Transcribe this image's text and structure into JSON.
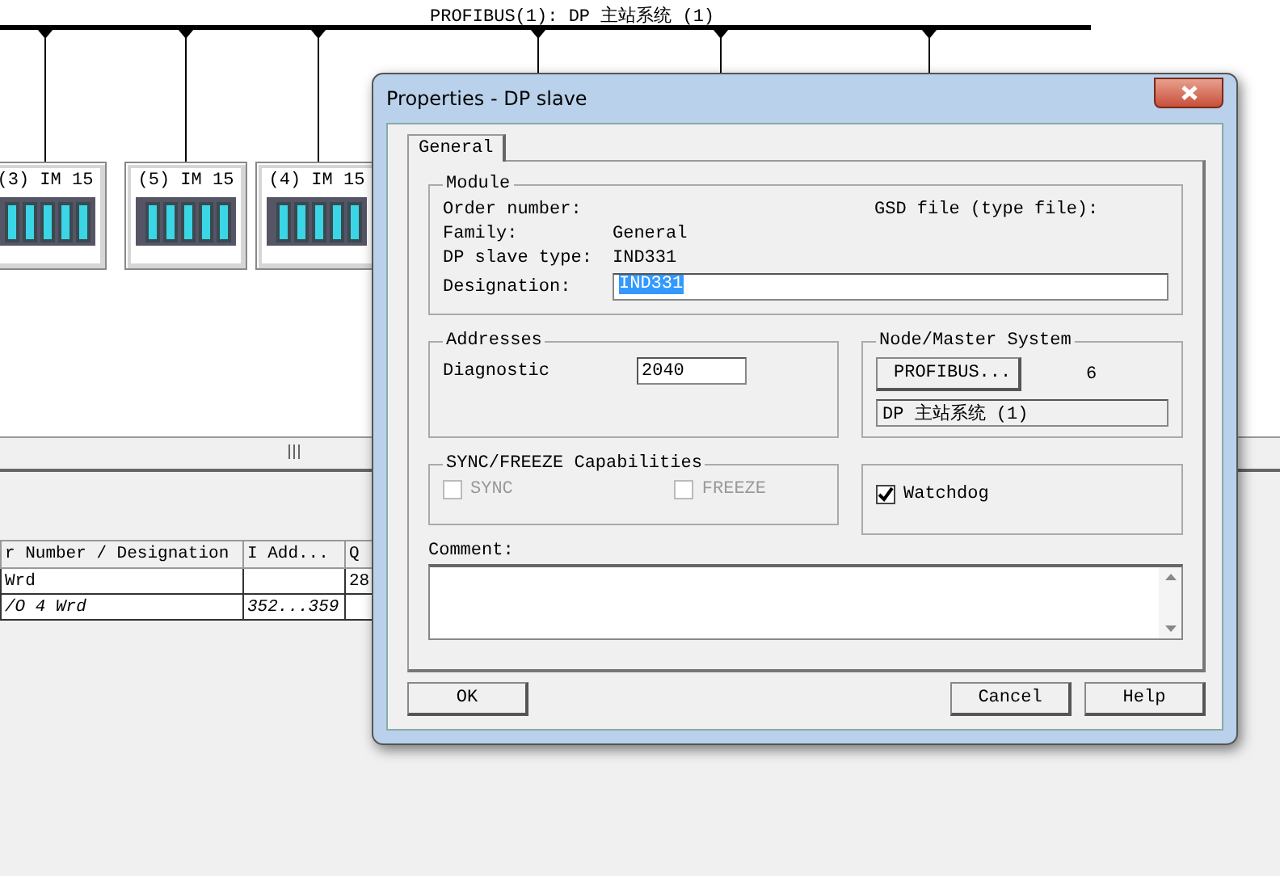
{
  "network": {
    "bus_label": "PROFIBUS(1): DP 主站系统 (1)",
    "stations": [
      {
        "label": "(3) IM 15"
      },
      {
        "label": "(5) IM 15"
      },
      {
        "label": "(4) IM 15"
      }
    ]
  },
  "table": {
    "columns": [
      "r Number / Designation",
      "I Add...",
      "Q"
    ],
    "rows": [
      {
        "cells": [
          "Wrd",
          "",
          "28"
        ],
        "italic": false
      },
      {
        "cells": [
          "/O 4 Wrd",
          "352...359",
          ""
        ],
        "italic": true
      }
    ]
  },
  "dialog": {
    "title": "Properties - DP slave",
    "tabs": [
      {
        "label": "General",
        "selected": true
      }
    ],
    "module": {
      "title": "Module",
      "order_number_label": "Order number:",
      "gsd_label": "GSD file (type file):",
      "family_label": "Family:",
      "family": "General",
      "type_label": "DP slave type:",
      "type": "IND331",
      "designation_label": "Designation:",
      "designation": "IND331"
    },
    "addresses": {
      "title": "Addresses",
      "diagnostic_label": "Diagnostic",
      "diagnostic": "2040"
    },
    "node": {
      "title": "Node/Master System",
      "button": "PROFIBUS...",
      "address": "6",
      "master": "DP 主站系统 (1)"
    },
    "sync": {
      "title": "SYNC/FREEZE Capabilities",
      "options": [
        {
          "label": "SYNC",
          "checked": false,
          "disabled": true
        },
        {
          "label": "FREEZE",
          "checked": false,
          "disabled": true
        }
      ]
    },
    "watchdog": {
      "label": "Watchdog",
      "checked": true
    },
    "comment_label": "Comment:",
    "buttons": [
      "OK",
      "Cancel",
      "Help"
    ]
  }
}
